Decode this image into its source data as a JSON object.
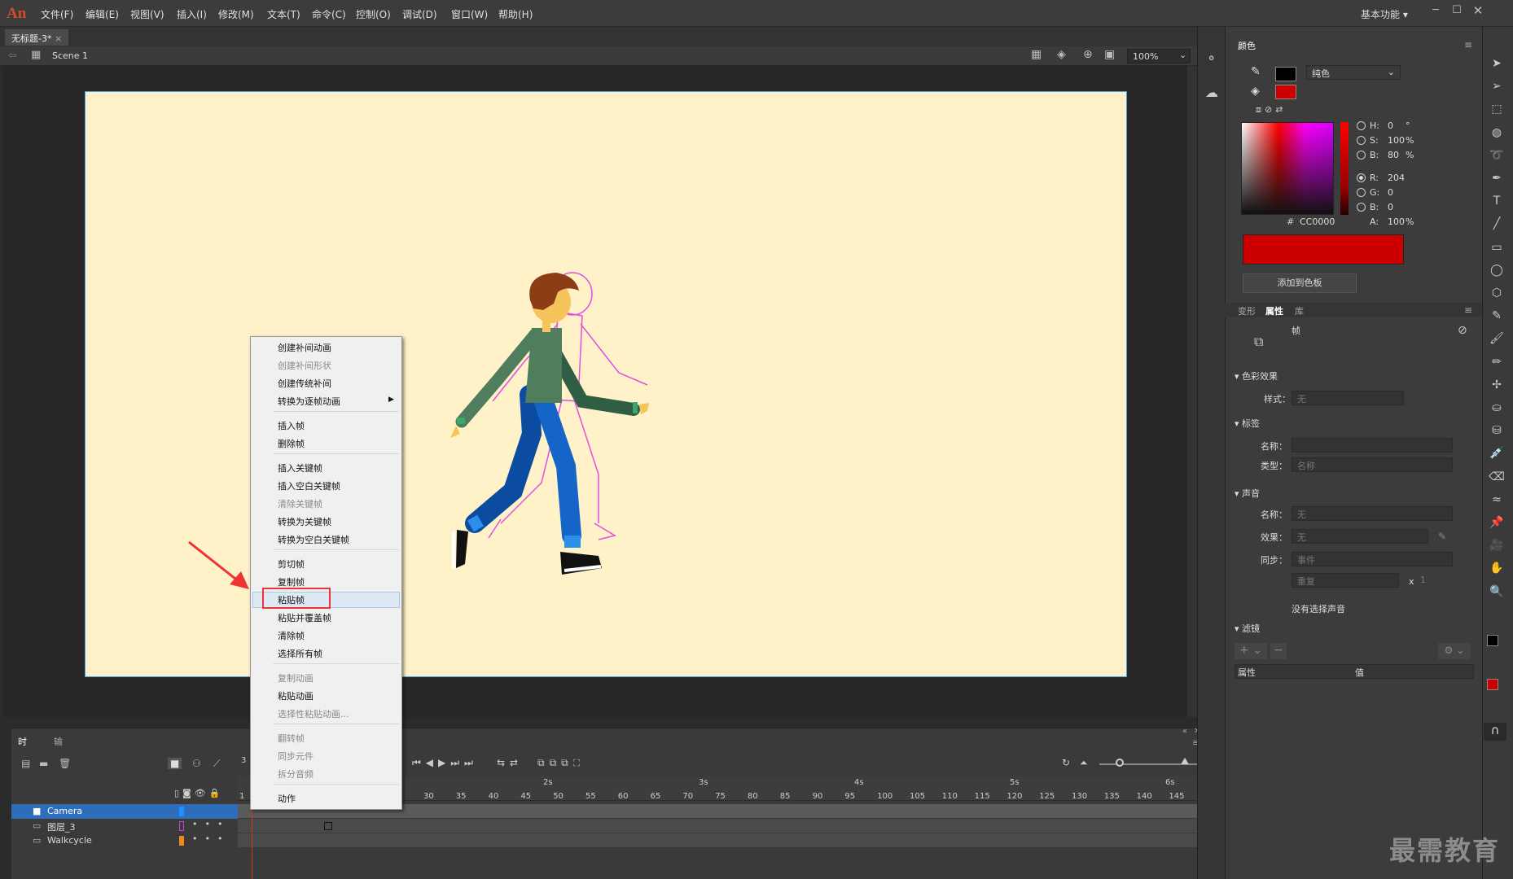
{
  "app": {
    "logo": "An"
  },
  "menu": [
    "文件(F)",
    "编辑(E)",
    "视图(V)",
    "插入(I)",
    "修改(M)",
    "文本(T)",
    "命令(C)",
    "控制(O)",
    "调试(D)",
    "窗口(W)",
    "帮助(H)"
  ],
  "workspace": "基本功能",
  "document": {
    "tab": "无标题-3*",
    "scene": "Scene 1",
    "zoom": "100%"
  },
  "context_menu": {
    "items": [
      {
        "label": "创建补间动画",
        "enabled": true
      },
      {
        "label": "创建补间形状",
        "enabled": false
      },
      {
        "label": "创建传统补间",
        "enabled": true
      },
      {
        "label": "转换为逐帧动画",
        "enabled": true,
        "submenu": true
      },
      {
        "label": "插入帧",
        "enabled": true
      },
      {
        "label": "删除帧",
        "enabled": true
      },
      {
        "label": "插入关键帧",
        "enabled": true
      },
      {
        "label": "插入空白关键帧",
        "enabled": true
      },
      {
        "label": "清除关键帧",
        "enabled": false
      },
      {
        "label": "转换为关键帧",
        "enabled": true
      },
      {
        "label": "转换为空白关键帧",
        "enabled": true
      },
      {
        "label": "剪切帧",
        "enabled": true
      },
      {
        "label": "复制帧",
        "enabled": true
      },
      {
        "label": "粘贴帧",
        "enabled": true,
        "highlighted": true
      },
      {
        "label": "粘贴并覆盖帧",
        "enabled": true
      },
      {
        "label": "清除帧",
        "enabled": true
      },
      {
        "label": "选择所有帧",
        "enabled": true
      },
      {
        "label": "复制动画",
        "enabled": false
      },
      {
        "label": "粘贴动画",
        "enabled": true
      },
      {
        "label": "选择性粘贴动画...",
        "enabled": false
      },
      {
        "label": "翻转帧",
        "enabled": false
      },
      {
        "label": "同步元件",
        "enabled": false
      },
      {
        "label": "拆分音频",
        "enabled": false
      },
      {
        "label": "动作",
        "enabled": true
      }
    ]
  },
  "timeline": {
    "tabs": [
      "时间轴",
      "输出"
    ],
    "layers": [
      {
        "name": "Camera",
        "color": "#1e90ff",
        "selected": true
      },
      {
        "name": "图层_3",
        "color": "#d040d0"
      },
      {
        "name": "Walkcycle",
        "color": "#f08a20"
      }
    ],
    "frame_label": "3",
    "seconds": [
      "2s",
      "3s",
      "4s",
      "5s",
      "6s"
    ],
    "ticks": [
      "30",
      "35",
      "40",
      "45",
      "50",
      "55",
      "60",
      "65",
      "70",
      "75",
      "80",
      "85",
      "90",
      "95",
      "100",
      "105",
      "110",
      "115",
      "120",
      "125",
      "130",
      "135",
      "140",
      "145"
    ],
    "frame_one": "1"
  },
  "color_panel": {
    "tab": "颜色",
    "fill_type": "纯色",
    "H": "0",
    "H_unit": "°",
    "S": "100",
    "S_unit": "%",
    "B": "80",
    "B_unit": "%",
    "R": "204",
    "G": "0",
    "Bv": "0",
    "hex": "CC0000",
    "A": "100",
    "A_unit": "%",
    "add_to_swatch": "添加到色板",
    "fill_color": "#cc0000"
  },
  "props_panel": {
    "tabs": [
      "变形",
      "属性",
      "库"
    ],
    "frame": "帧",
    "color_effect": "色彩效果",
    "style_label": "样式：",
    "style_value": "无",
    "label_section": "标签",
    "name_label": "名称：",
    "type_label": "类型：",
    "type_value": "名称",
    "sound_section": "声音",
    "sound_name_label": "名称：",
    "sound_name_value": "无",
    "effect_label": "效果：",
    "effect_value": "无",
    "sync_label": "同步：",
    "sync_value": "事件",
    "repeat_value": "重复",
    "repeat_x": "x",
    "repeat_count": "1",
    "no_sound": "没有选择声音",
    "filter_section": "滤镜",
    "col_prop": "属性",
    "col_value": "值"
  },
  "watermark": "最需教育"
}
